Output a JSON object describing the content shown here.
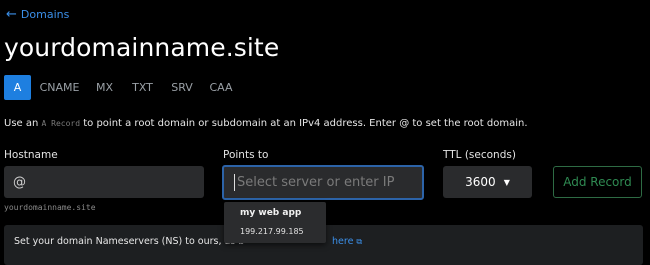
{
  "nav": {
    "back_label": "Domains"
  },
  "page_title": "yourdomainname.site",
  "tabs": [
    {
      "label": "A",
      "active": true
    },
    {
      "label": "CNAME",
      "active": false
    },
    {
      "label": "MX",
      "active": false
    },
    {
      "label": "TXT",
      "active": false
    },
    {
      "label": "SRV",
      "active": false
    },
    {
      "label": "CAA",
      "active": false
    }
  ],
  "description": {
    "prefix": "Use an ",
    "code": "A Record",
    "suffix": " to point a root domain or subdomain at an IPv4 address. Enter @ to set the root domain."
  },
  "form": {
    "hostname_label": "Hostname",
    "hostname_value": "@",
    "hostname_hint": "yourdomainname.site",
    "points_to_label": "Points to",
    "points_to_placeholder": "Select server or enter IP",
    "ttl_label": "TTL (seconds)",
    "ttl_value": "3600",
    "add_record_label": "Add Record"
  },
  "suggestion": {
    "name": "my web app",
    "ip": "199.217.99.185"
  },
  "banner": {
    "text": "Set your domain Nameservers (NS) to ours, as b",
    "link_label": "here"
  },
  "colors": {
    "accent": "#1e7fe0",
    "link": "#3b8fe8",
    "success_outline": "#2e6b44"
  }
}
